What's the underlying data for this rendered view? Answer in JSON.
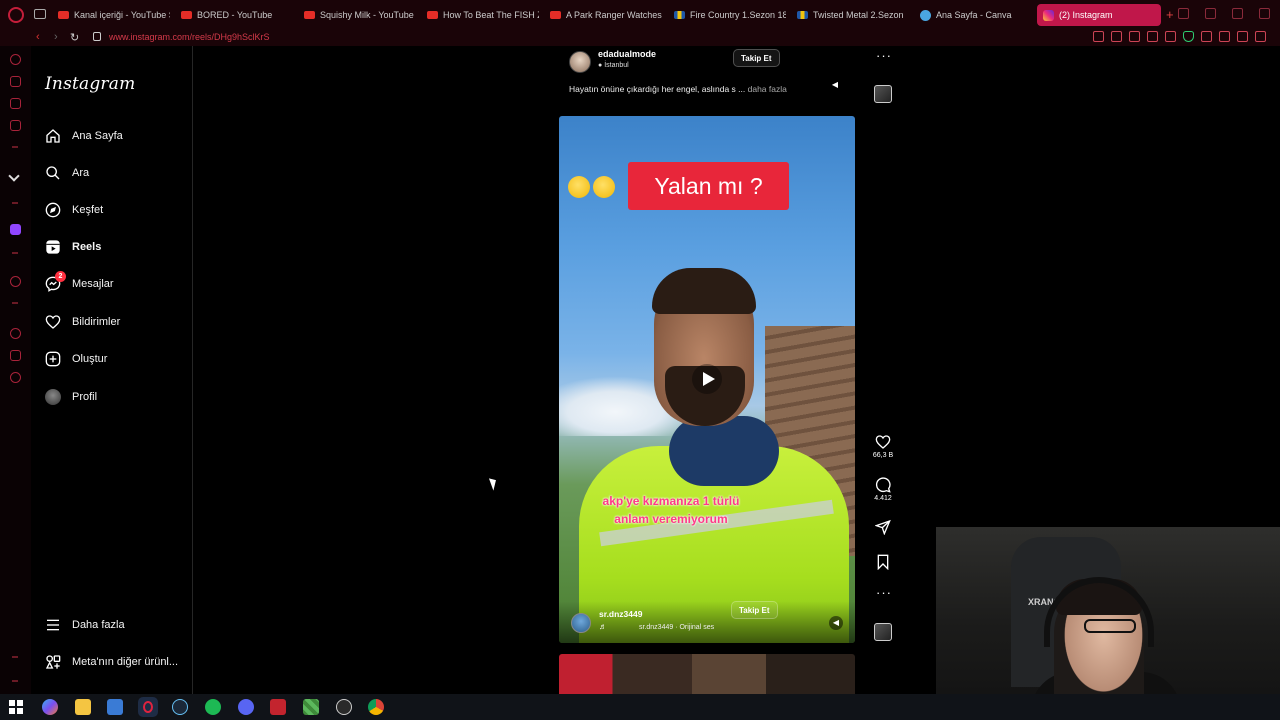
{
  "browser": {
    "tabs": [
      {
        "label": "Kanal içeriği - YouTube S",
        "favicon": "youtube-icon",
        "active": false
      },
      {
        "label": "BORED - YouTube",
        "favicon": "youtube-icon",
        "active": false
      },
      {
        "label": "Squishy Milk - YouTube",
        "favicon": "youtube-icon",
        "active": false
      },
      {
        "label": "How To Beat The FISH Z",
        "favicon": "youtube-icon",
        "active": false
      },
      {
        "label": "A Park Ranger Watches",
        "favicon": "youtube-icon",
        "active": false
      },
      {
        "label": "Fire Country 1.Sezon 18",
        "favicon": "flag-icon",
        "active": false
      },
      {
        "label": "Twisted Metal 2.Sezon",
        "favicon": "flag-icon",
        "active": false
      },
      {
        "label": "Ana Sayfa - Canva",
        "favicon": "canva-icon",
        "active": false
      },
      {
        "label": "(2) Instagram",
        "favicon": "instagram-icon",
        "active": true
      }
    ],
    "new_tab": "+",
    "url": "www.instagram.com/reels/DHg9hSclKrS",
    "accent": "#c0174a"
  },
  "instagram": {
    "logo": "Instagram",
    "nav": [
      {
        "label": "Ana Sayfa",
        "icon": "home-icon"
      },
      {
        "label": "Ara",
        "icon": "search-icon"
      },
      {
        "label": "Keşfet",
        "icon": "compass-icon"
      },
      {
        "label": "Reels",
        "icon": "reels-icon",
        "active": true
      },
      {
        "label": "Mesajlar",
        "icon": "messenger-icon",
        "badge": "2"
      },
      {
        "label": "Bildirimler",
        "icon": "heart-icon"
      },
      {
        "label": "Oluştur",
        "icon": "plus-square-icon"
      },
      {
        "label": "Profil",
        "icon": "avatar"
      }
    ],
    "more": "Daha fazla",
    "meta": "Meta'nın diğer ürünl..."
  },
  "reel_prev": {
    "username": "edadualmode",
    "location": "İstanbul",
    "follow": "Takip Et",
    "caption": "Hayatın önüne çıkardığı her engel, aslında s ...",
    "more": "daha fazla"
  },
  "reel": {
    "title_badge": "Yalan mı ?",
    "overlay_line1": "akp'ye kızmanıza 1 türlü",
    "overlay_line2": "anlam veremiyorum",
    "username": "sr.dnz3449",
    "follow": "Takip Et",
    "note": "♬",
    "audio": "sr.dnz3449 · Orijinal ses",
    "likes": "66,3 B",
    "comments": "4.412"
  },
  "webcam": {
    "chair_brand": "XRANC"
  },
  "taskbar": {
    "apps": [
      "windows-icon",
      "copilot-icon",
      "file-explorer-icon",
      "store-icon",
      "opera-icon",
      "steam-icon",
      "spotify-icon",
      "discord-icon",
      "voice-app-icon",
      "minecraft-icon",
      "obs-icon",
      "chrome-icon"
    ]
  }
}
